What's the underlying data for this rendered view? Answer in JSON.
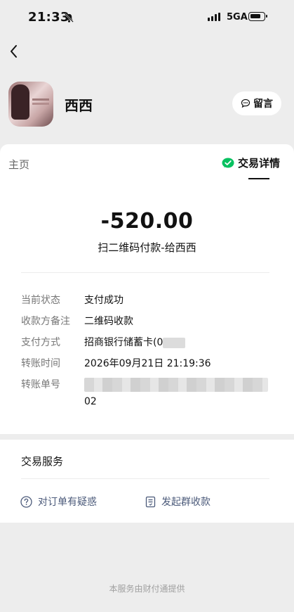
{
  "status_bar": {
    "time": "21:33",
    "network": "5GA",
    "icons": [
      "bell-muted-icon",
      "signal-icon",
      "battery-icon"
    ]
  },
  "header": {
    "payee_name": "西西",
    "message_button_label": "留言"
  },
  "tabs": {
    "home_label": "主页",
    "detail_label": "交易详情"
  },
  "transaction": {
    "amount": "-520.00",
    "description": "扫二维码付款-给西西",
    "fields": [
      {
        "key": "当前状态",
        "value": "支付成功"
      },
      {
        "key": "收款方备注",
        "value": "二维码收款"
      },
      {
        "key": "支付方式",
        "value": "招商银行储蓄卡(0"
      },
      {
        "key": "转账时间",
        "value": "2026年09月21日 21:19:36"
      },
      {
        "key": "转账单号",
        "value": "02"
      }
    ]
  },
  "services": {
    "title": "交易服务",
    "items": [
      {
        "label": "对订单有疑惑",
        "icon": "question-circle-icon"
      },
      {
        "label": "发起群收款",
        "icon": "bill-icon"
      }
    ]
  },
  "footer": {
    "text": "本服务由财付通提供"
  },
  "colors": {
    "background": "#ededed",
    "card": "#ffffff",
    "wechat_green": "#07c160",
    "link_blue_gray": "#4b5a7a"
  }
}
